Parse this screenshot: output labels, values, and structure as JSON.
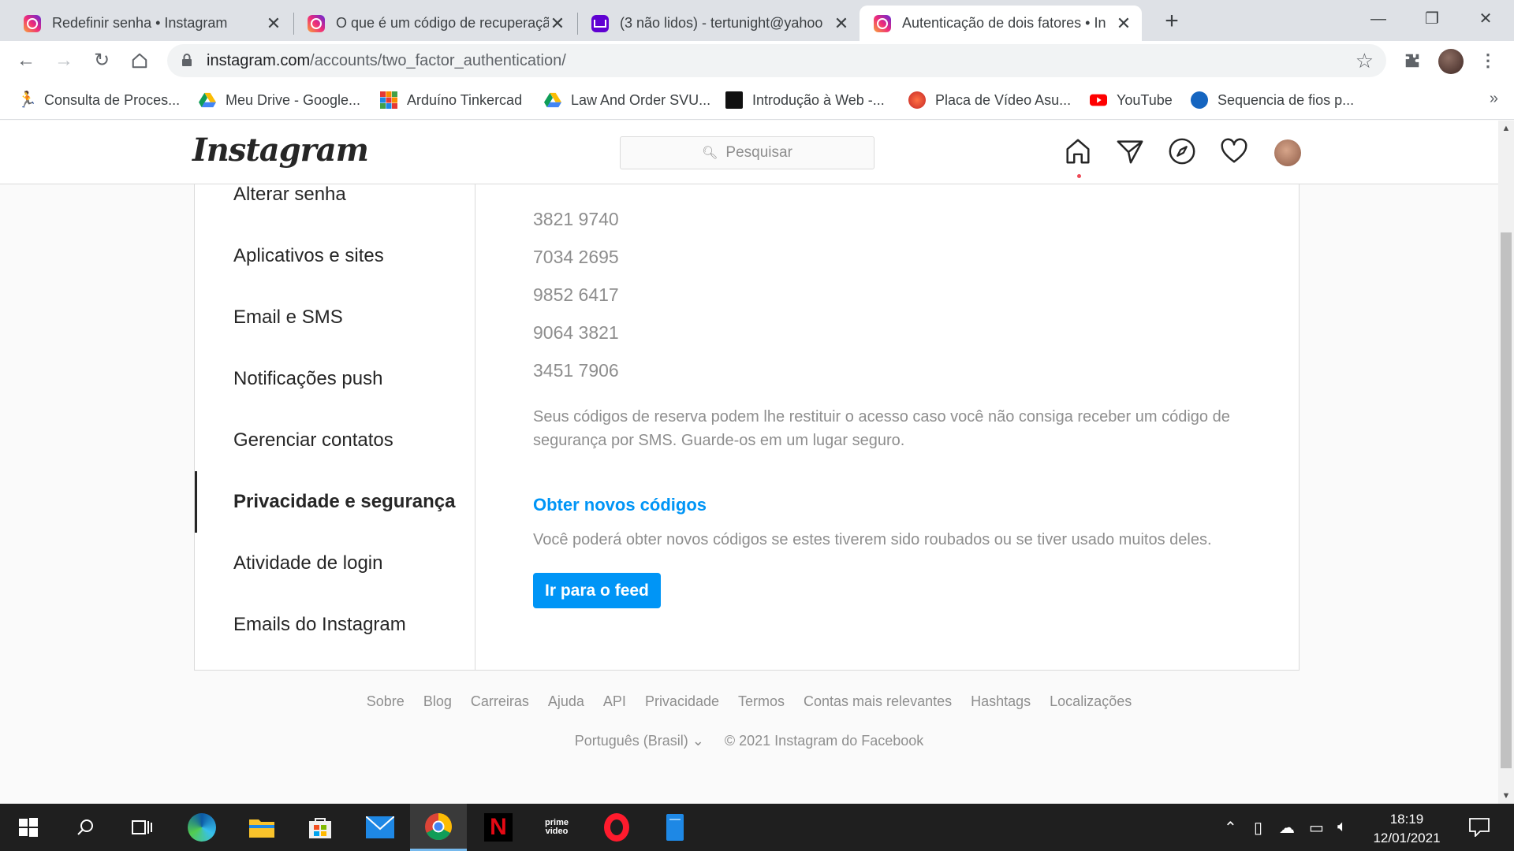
{
  "browser": {
    "tabs": [
      {
        "title": "Redefinir senha • Instagram",
        "favicon": "instagram-icon"
      },
      {
        "title": "O que é um código de recuperação",
        "favicon": "instagram-icon"
      },
      {
        "title": "(3 não lidos) - tertunight@yahoo",
        "favicon": "yahoo-mail-icon"
      },
      {
        "title": "Autenticação de dois fatores • In",
        "favicon": "instagram-icon"
      }
    ],
    "active_tab_index": 3,
    "address": {
      "host": "instagram.com",
      "path": "/accounts/two_factor_authentication/"
    },
    "bookmarks": [
      {
        "label": "Consulta de Proces..."
      },
      {
        "label": "Meu Drive - Google..."
      },
      {
        "label": "Arduíno Tinkercad"
      },
      {
        "label": "Law And Order SVU..."
      },
      {
        "label": "Introdução à Web -..."
      },
      {
        "label": "Placa de Vídeo Asu..."
      },
      {
        "label": "YouTube"
      },
      {
        "label": "Sequencia de fios p..."
      }
    ]
  },
  "instagram": {
    "logo": "Instagram",
    "search_placeholder": "Pesquisar",
    "sidebar": [
      {
        "label": "Alterar senha"
      },
      {
        "label": "Aplicativos e sites"
      },
      {
        "label": "Email e SMS"
      },
      {
        "label": "Notificações push"
      },
      {
        "label": "Gerenciar contatos"
      },
      {
        "label": "Privacidade e segurança",
        "active": true
      },
      {
        "label": "Atividade de login"
      },
      {
        "label": "Emails do Instagram"
      }
    ],
    "backup_codes": [
      "3821 9740",
      "7034 2695",
      "9852 6417",
      "9064 3821",
      "3451 7906"
    ],
    "codes_description": "Seus códigos de reserva podem lhe restituir o acesso caso você não consiga receber um código de segurança por SMS. Guarde-os em um lugar seguro.",
    "new_codes_link": "Obter novos códigos",
    "new_codes_description": "Você poderá obter novos códigos se estes tiverem sido roubados ou se tiver usado muitos deles.",
    "feed_button": "Ir para o feed",
    "footer_links": [
      "Sobre",
      "Blog",
      "Carreiras",
      "Ajuda",
      "API",
      "Privacidade",
      "Termos",
      "Contas mais relevantes",
      "Hashtags",
      "Localizações"
    ],
    "language": "Português (Brasil)",
    "copyright": "© 2021 Instagram do Facebook",
    "colors": {
      "accent": "#0095f6",
      "text": "#262626",
      "muted": "#8e8e8e",
      "border": "#dbdbdb"
    }
  },
  "taskbar": {
    "time": "18:19",
    "date": "12/01/2021"
  }
}
